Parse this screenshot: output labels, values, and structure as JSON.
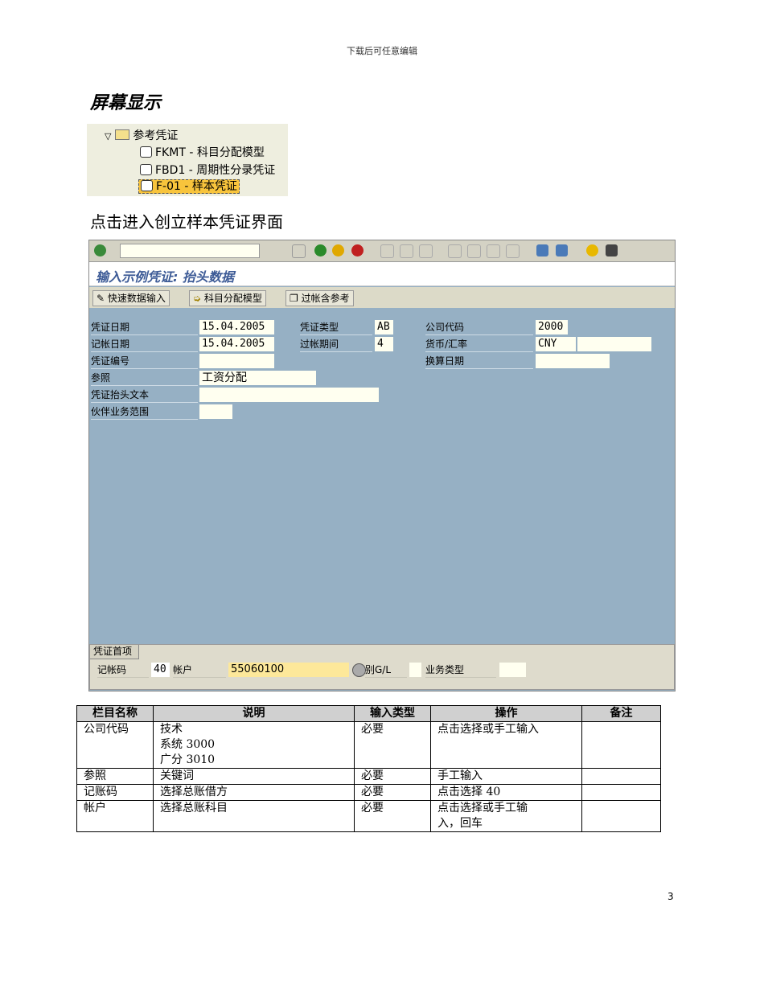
{
  "header": "下载后可任意编辑",
  "section_title": "屏幕显示",
  "tree": {
    "folder": "参考凭证",
    "items": [
      "FKMT - 科目分配模型",
      "FBD1 - 周期性分录凭证",
      "F-01 - 样本凭证"
    ]
  },
  "intro": "点击进入创立样本凭证界面",
  "sap": {
    "title": "输入示例凭证: 抬头数据",
    "buttons": [
      "快速数据输入",
      "科目分配模型",
      "过帐含参考"
    ],
    "fields": {
      "doc_date": {
        "label": "凭证日期",
        "value": "15.04.2005"
      },
      "post_date": {
        "label": "记帐日期",
        "value": "15.04.2005"
      },
      "doc_no": {
        "label": "凭证编号",
        "value": ""
      },
      "ref": {
        "label": "参照",
        "value": "工资分配"
      },
      "header_text": {
        "label": "凭证抬头文本",
        "value": ""
      },
      "partner": {
        "label": "伙伴业务范围",
        "value": ""
      },
      "doc_type": {
        "label": "凭证类型",
        "value": "AB"
      },
      "period": {
        "label": "过帐期间",
        "value": "4"
      },
      "company": {
        "label": "公司代码",
        "value": "2000"
      },
      "currency": {
        "label": "货币/汇率",
        "value": "CNY"
      },
      "trans_date": {
        "label": "换算日期",
        "value": ""
      }
    },
    "bottom": {
      "tab": "凭证首项",
      "posting_key": {
        "label": "记帐码",
        "value": "40"
      },
      "account": {
        "label": "帐户",
        "value": "55060100"
      },
      "special_gl": "别G/L",
      "trans_type": "业务类型"
    }
  },
  "table": {
    "headers": [
      "栏目名称",
      "说明",
      "输入类型",
      "操作",
      "备注"
    ],
    "rows": [
      [
        "公司代码",
        "技术\n系统 3000\n广分 3010",
        "必要",
        "点击选择或手工输入",
        ""
      ],
      [
        "参照",
        "关键词",
        "必要",
        "手工输入",
        ""
      ],
      [
        "记账码",
        "选择总账借方",
        "必要",
        "点击选择 40",
        ""
      ],
      [
        "帐户",
        "选择总账科目",
        "必要",
        "点击选择或手工输\n入，回车",
        ""
      ]
    ]
  },
  "page_number": "3"
}
